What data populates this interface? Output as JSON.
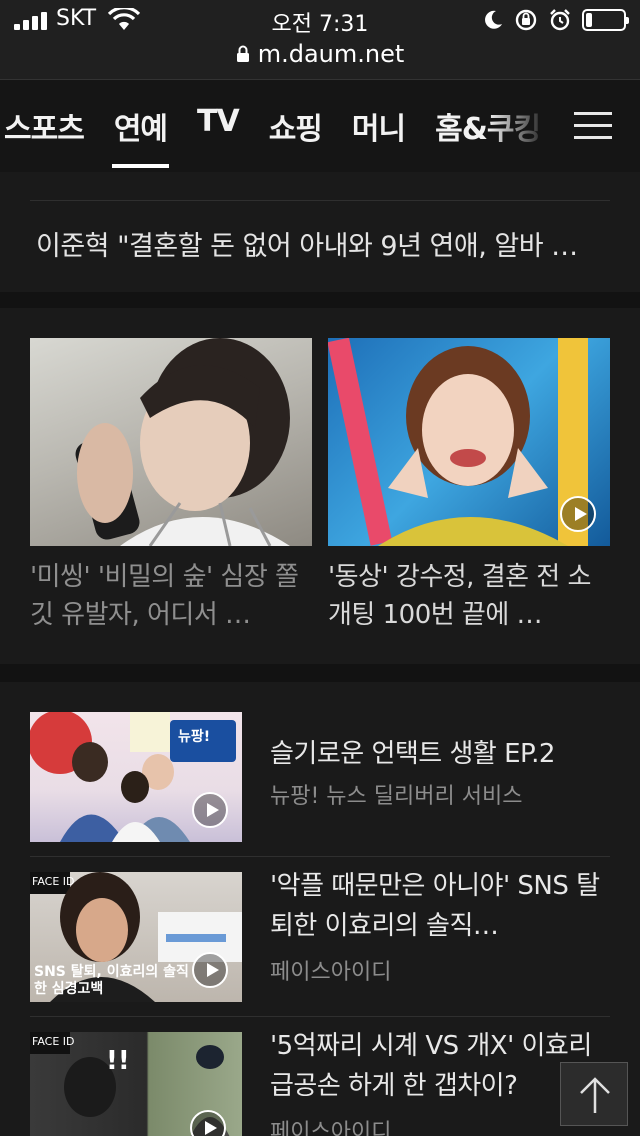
{
  "status_bar": {
    "carrier": "SKT",
    "time": "오전 7:31"
  },
  "browser": {
    "url": "m.daum.net"
  },
  "nav": {
    "categories": [
      "스포츠",
      "연예",
      "TV",
      "쇼핑",
      "머니",
      "홈&쿠킹"
    ],
    "active": "연예"
  },
  "section1": {
    "headline": "이준혁 \"결혼할 돈 없어 아내와 9년 연애, 알바 …"
  },
  "section2": {
    "cards": [
      {
        "title": "'미씽' '비밀의 숲' 심장 쫄깃 유발자, 어디서 …",
        "read": true
      },
      {
        "title": "'동상' 강수정, 결혼 전 소개팅 100번 끝에 …",
        "read": false
      }
    ]
  },
  "section3": {
    "items": [
      {
        "title": "슬기로운 언택트 생활 EP.2",
        "source": "뉴팡! 뉴스 딜리버리 서비스",
        "thumb_badge": "뉴팡!",
        "thumb_caption": ""
      },
      {
        "title": "'악플 때문만은 아니야' SNS 탈퇴한 이효리의 솔직…",
        "source": "페이스아이디",
        "thumb_badge": "FACE ID",
        "thumb_caption": "SNS 탈퇴, 이효리의 솔직한 심경고백"
      },
      {
        "title": "'5억짜리 시계 VS 개X' 이효리 급공손 하게 한 갭차이?",
        "source": "페이스아이디",
        "thumb_badge": "FACE ID",
        "thumb_caption": "!!"
      }
    ]
  },
  "colors": {
    "background": "#121212",
    "card_bg": "#1a1a1a",
    "text": "#e8e8e8",
    "muted": "#8c8c8c"
  }
}
